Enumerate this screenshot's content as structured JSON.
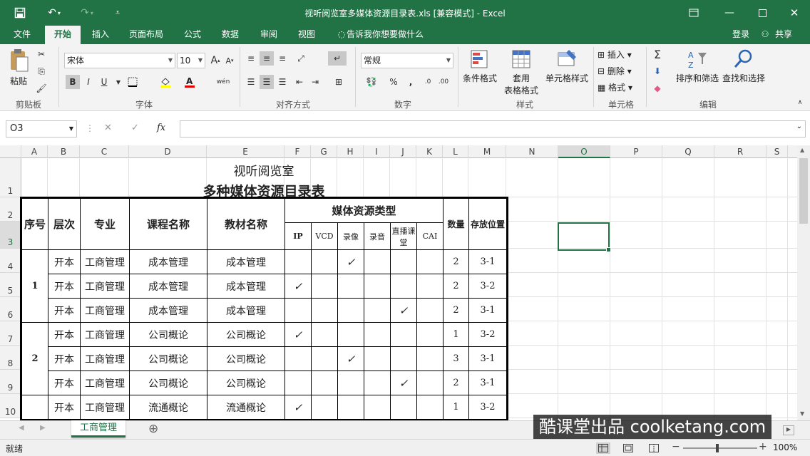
{
  "titlebar": {
    "title": "视听阅览室多媒体资源目录表.xls  [兼容模式] - Excel"
  },
  "menubar": {
    "file": "文件",
    "tabs": [
      "开始",
      "插入",
      "页面布局",
      "公式",
      "数据",
      "审阅",
      "视图"
    ],
    "tell_me": "告诉我你想要做什么",
    "login": "登录",
    "share": "共享"
  },
  "ribbon": {
    "clipboard": {
      "paste": "粘贴",
      "label": "剪贴板"
    },
    "font": {
      "name": "宋体",
      "size": "10",
      "label": "字体",
      "grow": "A",
      "shrink": "A",
      "bold": "B",
      "italic": "I",
      "underline": "U",
      "phonetic": "wén"
    },
    "align": {
      "label": "对齐方式"
    },
    "number": {
      "format": "常规",
      "label": "数字",
      "percent": "%",
      "comma": ","
    },
    "styles": {
      "cond": "条件格式",
      "table": "套用",
      "table2": "表格格式",
      "cell": "单元格样式",
      "label": "样式"
    },
    "cells": {
      "insert": "插入",
      "delete": "删除",
      "format": "格式",
      "label": "单元格"
    },
    "editing": {
      "sort": "排序和筛选",
      "find": "查找和选择",
      "label": "编辑",
      "sigma": "Σ"
    }
  },
  "formula": {
    "namebox": "O3",
    "fx": "fx"
  },
  "columns": [
    "A",
    "B",
    "C",
    "D",
    "E",
    "F",
    "G",
    "H",
    "I",
    "J",
    "K",
    "L",
    "M",
    "N",
    "O",
    "P",
    "Q",
    "R",
    "S"
  ],
  "rows": [
    "1",
    "2",
    "3",
    "4",
    "5",
    "6",
    "7",
    "8",
    "9",
    "10"
  ],
  "sheet": {
    "title1": "视听阅览室",
    "title2": "多种媒体资源目录表",
    "headers": {
      "seq": "序号",
      "level": "层次",
      "major": "专业",
      "course": "课程名称",
      "textbook": "教材名称",
      "media": "媒体资源类型",
      "media_types": [
        "IP",
        "VCD",
        "录像",
        "录音",
        "直播课堂",
        "CAI"
      ],
      "qty": "数量",
      "loc": "存放位置"
    },
    "check": "✓",
    "groups": [
      {
        "seq": "1",
        "rows": [
          {
            "level": "开本",
            "major": "工商管理",
            "course": "成本管理",
            "textbook": "成本管理",
            "mark": 2,
            "qty": "2",
            "loc": "3-1"
          },
          {
            "level": "开本",
            "major": "工商管理",
            "course": "成本管理",
            "textbook": "成本管理",
            "mark": 0,
            "qty": "2",
            "loc": "3-2"
          },
          {
            "level": "开本",
            "major": "工商管理",
            "course": "成本管理",
            "textbook": "成本管理",
            "mark": 4,
            "qty": "2",
            "loc": "3-1"
          }
        ]
      },
      {
        "seq": "2",
        "rows": [
          {
            "level": "开本",
            "major": "工商管理",
            "course": "公司概论",
            "textbook": "公司概论",
            "mark": 0,
            "qty": "1",
            "loc": "3-2"
          },
          {
            "level": "开本",
            "major": "工商管理",
            "course": "公司概论",
            "textbook": "公司概论",
            "mark": 2,
            "qty": "3",
            "loc": "3-1"
          },
          {
            "level": "开本",
            "major": "工商管理",
            "course": "公司概论",
            "textbook": "公司概论",
            "mark": 4,
            "qty": "2",
            "loc": "3-1"
          }
        ]
      },
      {
        "seq": "",
        "rows": [
          {
            "level": "开本",
            "major": "工商管理",
            "course": "流通概论",
            "textbook": "流通概论",
            "mark": 0,
            "qty": "1",
            "loc": "3-2"
          }
        ]
      }
    ]
  },
  "sheettabs": {
    "active": "工商管理",
    "add": "⊕"
  },
  "status": {
    "ready": "就绪",
    "zoom": "100%"
  },
  "watermark": "酷课堂出品 coolketang.com"
}
